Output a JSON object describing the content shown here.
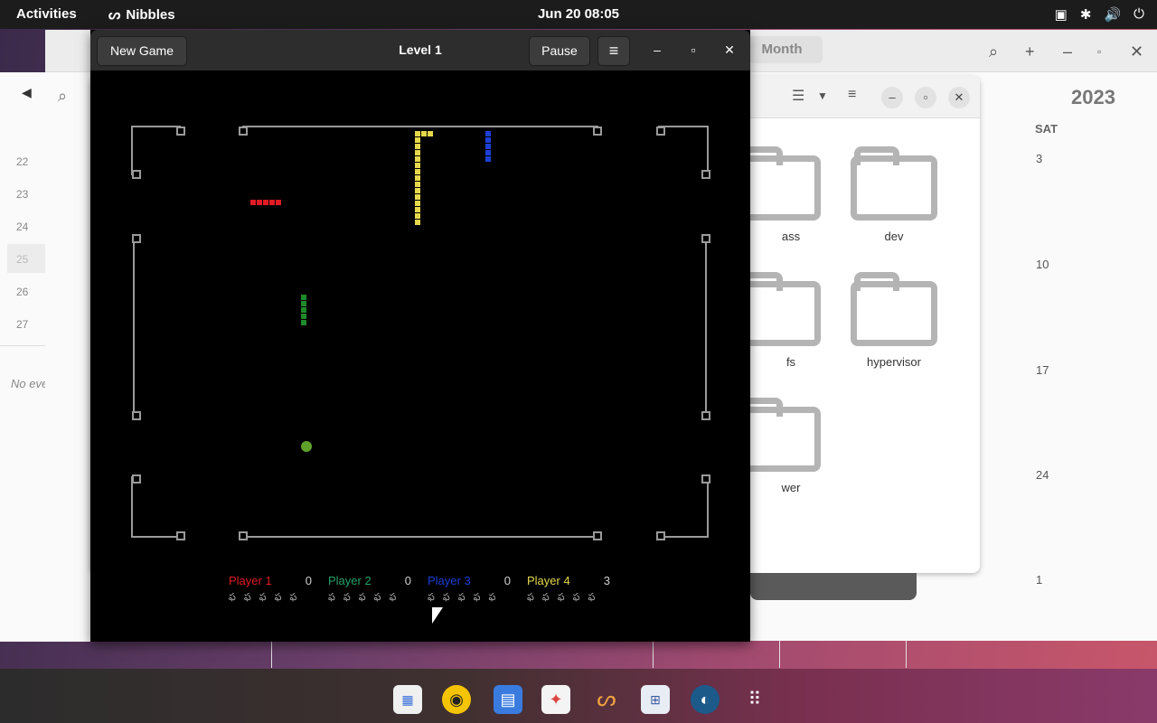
{
  "topbar": {
    "activities": "Activities",
    "app_name": "Nibbles",
    "clock": "Jun 20  08:05",
    "icons": [
      "network-icon",
      "accessibility-icon",
      "volume-icon",
      "power-icon"
    ]
  },
  "calendar": {
    "month_button": "Month",
    "year": "2023",
    "day_header": "SAT",
    "week_numbers": [
      "22",
      "23",
      "24",
      "25",
      "26",
      "27"
    ],
    "saturday_days": [
      "3",
      "10",
      "17",
      "24",
      "1"
    ],
    "no_events": "No events"
  },
  "files": {
    "folders": [
      {
        "name": "ass"
      },
      {
        "name": "dev"
      },
      {
        "name": "fs"
      },
      {
        "name": "hypervisor"
      },
      {
        "name": "wer"
      }
    ]
  },
  "nibbles": {
    "new_game": "New Game",
    "title": "Level 1",
    "pause": "Pause",
    "players": [
      {
        "name": "Player 1",
        "score": "0",
        "color": "#e01b24"
      },
      {
        "name": "Player 2",
        "score": "0",
        "color": "#26a269"
      },
      {
        "name": "Player 3",
        "score": "0",
        "color": "#1c3fd6"
      },
      {
        "name": "Player 4",
        "score": "3",
        "color": "#e5d84a"
      }
    ],
    "lives_glyph": "ఫ ఫ ఫ ఫ ఫ"
  },
  "dock": {
    "apps": [
      "calendar-icon",
      "rhythmbox-icon",
      "files-icon",
      "software-icon",
      "nibbles-icon",
      "sudoku-icon",
      "screenshot-icon",
      "app-grid-icon"
    ]
  }
}
